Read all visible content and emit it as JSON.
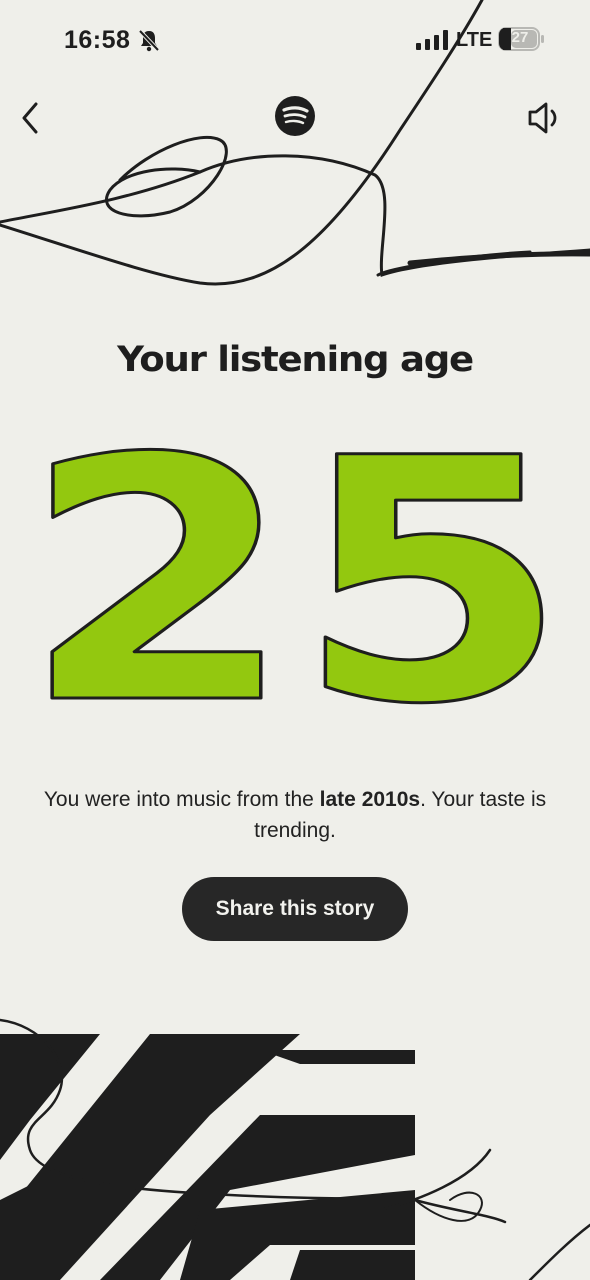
{
  "status_bar": {
    "time": "16:58",
    "network": "LTE",
    "battery": "27"
  },
  "nav": {
    "back_icon": "chevron-left-icon",
    "logo_icon": "spotify-logo-icon",
    "sound_icon": "speaker-icon"
  },
  "story": {
    "title": "Your listening age",
    "age": "25",
    "description_prefix": "You were into music from the ",
    "description_highlight": "late 2010s",
    "description_suffix": ". Your taste is trending.",
    "share_label": "Share this story"
  },
  "colors": {
    "background": "#efefea",
    "accent_green": "#93c80f",
    "ink": "#1e1e1e"
  }
}
